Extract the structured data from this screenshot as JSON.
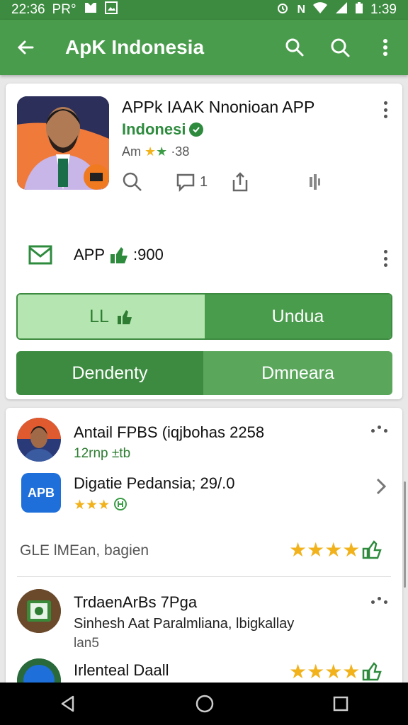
{
  "status_bar": {
    "time_left": "22:36",
    "carrier": "PR°",
    "time_right": "1:39"
  },
  "app_bar": {
    "title": "ApK Indonesia"
  },
  "app_card": {
    "name": "APPk IAAK Nnonioan APP",
    "developer": "Indonesi",
    "rating_prefix": "Am",
    "rating_suffix": "·38",
    "comment_count": "1",
    "app_row_label": "APP",
    "app_row_value": ":900",
    "seg1_left": "LL",
    "seg1_right": "Undua",
    "seg2_left": "Dendenty",
    "seg2_right": "Dmneara"
  },
  "list": [
    {
      "title": "Antail FPBS (iqjbohas 2258",
      "subtitle": "12rnp ±tb"
    },
    {
      "title": "Digatie Pedansia; 29/.0",
      "logo_text": "APB"
    },
    {
      "footer": "GLE lMEan, bagien"
    },
    {
      "title": "TrdaenArBs 7Pga",
      "subtitle": "Sinhesh Aat Paralmliana, lbigkallay",
      "sub2": "lan5"
    },
    {
      "title": "Irlenteal Daall"
    }
  ],
  "colors": {
    "primary": "#4a9c4d",
    "dark": "#3d8b40",
    "light": "#b5e6b1",
    "star": "#f2b21c"
  }
}
